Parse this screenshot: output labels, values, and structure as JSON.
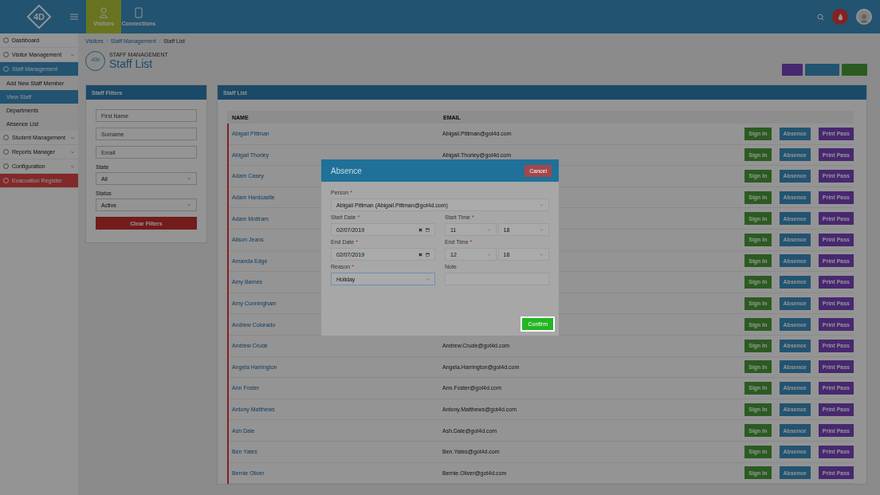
{
  "header": {
    "logo_text": "4D",
    "nav": [
      {
        "label": "Visitors",
        "selected": true
      },
      {
        "label": "Connections",
        "selected": false
      }
    ]
  },
  "sidebar": {
    "items": [
      {
        "label": "Dashboard",
        "expandable": false,
        "selected": false,
        "kind": "normal"
      },
      {
        "label": "Visitor Management",
        "expandable": true,
        "selected": false,
        "kind": "normal"
      },
      {
        "label": "Staff Management",
        "expandable": true,
        "selected": true,
        "kind": "normal",
        "children": [
          {
            "label": "Add New Staff Member",
            "selected": false
          },
          {
            "label": "View Staff",
            "selected": true
          },
          {
            "label": "Departments",
            "selected": false
          },
          {
            "label": "Absence List",
            "selected": false
          }
        ]
      },
      {
        "label": "Student Management",
        "expandable": true,
        "selected": false,
        "kind": "normal"
      },
      {
        "label": "Reports Manager",
        "expandable": true,
        "selected": false,
        "kind": "normal"
      },
      {
        "label": "Configuration",
        "expandable": true,
        "selected": false,
        "kind": "normal"
      },
      {
        "label": "Evacuation Register",
        "expandable": false,
        "selected": false,
        "kind": "alert"
      }
    ]
  },
  "breadcrumb": [
    "Visitors",
    "Staff Management",
    "Staff List"
  ],
  "page": {
    "subtitle": "STAFF MANAGEMENT",
    "title": "Staff List"
  },
  "filters": {
    "title": "Staff Filters",
    "fields": [
      {
        "kind": "text",
        "placeholder": "First Name"
      },
      {
        "kind": "text",
        "placeholder": "Surname"
      },
      {
        "kind": "text",
        "placeholder": "Email"
      },
      {
        "kind": "select",
        "label": "State",
        "value": "All"
      },
      {
        "kind": "select",
        "label": "Status",
        "value": "Active"
      }
    ],
    "button": "Clear Filters"
  },
  "staff_list": {
    "title": "Staff List",
    "columns": [
      "NAME",
      "EMAIL"
    ],
    "rows": [
      {
        "name": "Abigail Pittman",
        "email": "Abigail.Pittman@got4d.com",
        "actions": [
          "Sign In",
          "Absence",
          "Print Pass"
        ]
      },
      {
        "name": "Abigail Thorley",
        "email": "Abigail.Thorley@got4d.com",
        "actions": [
          "Sign In",
          "Absence",
          "Print Pass"
        ]
      },
      {
        "name": "Adam Casey",
        "actions": [
          "Sign In",
          "Absence",
          "Print Pass"
        ]
      },
      {
        "name": "Adam Hardcastle",
        "actions": [
          "Sign In",
          "Absence",
          "Print Pass"
        ]
      },
      {
        "name": "Adam Mottram",
        "actions": [
          "Sign In",
          "Absence",
          "Print Pass"
        ]
      },
      {
        "name": "Alison Jeans",
        "actions": [
          "Sign In",
          "Absence",
          "Print Pass"
        ]
      },
      {
        "name": "Amanda Edge",
        "actions": [
          "Sign In",
          "Absence",
          "Print Pass"
        ]
      },
      {
        "name": "Amy Barnes",
        "actions": [
          "Sign In",
          "Absence",
          "Print Pass"
        ]
      },
      {
        "name": "Amy Cunningham",
        "actions": [
          "Sign In",
          "Absence",
          "Print Pass"
        ]
      },
      {
        "name": "Andrew Colorado",
        "actions": [
          "Sign In",
          "Absence",
          "Print Pass"
        ]
      },
      {
        "name": "Andrew Crude",
        "email": "Andrew.Crude@got4d.com",
        "actions": [
          "Sign In",
          "Absence",
          "Print Pass"
        ]
      },
      {
        "name": "Angela Harrington",
        "email": "Angela.Harrington@got4d.com",
        "actions": [
          "Sign In",
          "Absence",
          "Print Pass"
        ]
      },
      {
        "name": "Ann Foster",
        "email": "Ann.Foster@got4d.com",
        "actions": [
          "Sign In",
          "Absence",
          "Print Pass"
        ]
      },
      {
        "name": "Antony Matthews",
        "email": "Antony.Matthews@got4d.com",
        "actions": [
          "Sign In",
          "Absence",
          "Print Pass"
        ]
      },
      {
        "name": "Ash Dale",
        "email": "Ash.Dale@got4d.com",
        "actions": [
          "Sign In",
          "Absence",
          "Print Pass"
        ]
      },
      {
        "name": "Ben Yates",
        "email": "Ben.Yates@got4d.com",
        "actions": [
          "Sign In",
          "Absence",
          "Print Pass"
        ]
      },
      {
        "name": "Bernie Oliver",
        "email": "Bernie.Oliver@got4d.com",
        "actions": [
          "Sign In",
          "Absence",
          "Print Pass"
        ]
      }
    ]
  },
  "modal": {
    "title": "Absence",
    "cancel": "Cancel",
    "confirm": "Confirm",
    "fields": [
      {
        "kind": "select",
        "label": "Person",
        "mark": "*",
        "value": "Abigail Pittman (Abigail.Pittman@got4d.com)",
        "wide": true
      },
      {
        "kind": "date",
        "label": "Start Date",
        "mark": "*",
        "value": "02/07/2019"
      },
      {
        "kind": "time",
        "label": "Start Time",
        "mark": "*",
        "hour": "11",
        "minute": "18"
      },
      {
        "kind": "date",
        "label": "End Date",
        "mark": "*",
        "value": "02/07/2019"
      },
      {
        "kind": "time",
        "label": "End Time",
        "mark": "*",
        "hour": "12",
        "minute": "18"
      },
      {
        "kind": "select",
        "label": "Reason",
        "mark": "*",
        "value": "Holiday",
        "focused": true
      },
      {
        "kind": "text",
        "label": "Note"
      }
    ]
  }
}
